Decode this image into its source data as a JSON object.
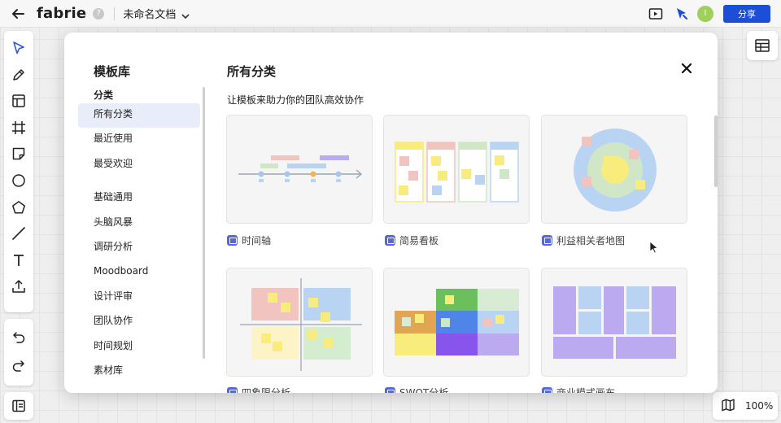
{
  "topbar": {
    "brand": "fabrie",
    "help": "?",
    "doc_title": "未命名文档",
    "avatar_initial": "I",
    "share_label": "分享"
  },
  "left_tools": [
    "select-icon",
    "pen-icon",
    "template-icon",
    "frame-icon",
    "sticky-note-icon",
    "circle-icon",
    "polygon-icon",
    "line-icon",
    "text-icon",
    "upload-icon"
  ],
  "history_tools": [
    "undo-icon",
    "redo-icon"
  ],
  "zoom": {
    "value": "100%"
  },
  "modal": {
    "library_title": "模板库",
    "category_heading": "分类",
    "categories_top": [
      "所有分类",
      "最近使用",
      "最受欢迎"
    ],
    "categories_bottom": [
      "基础通用",
      "头脑风暴",
      "调研分析",
      "Moodboard",
      "设计评审",
      "团队协作",
      "时间规划",
      "素材库"
    ],
    "active_category": "所有分类",
    "main_title": "所有分类",
    "subtitle": "让模板来助力你的团队高效协作",
    "templates": [
      {
        "name": "时间轴"
      },
      {
        "name": "简易看板"
      },
      {
        "name": "利益相关者地图"
      },
      {
        "name": "四象限分析"
      },
      {
        "name": "SWOT分析"
      },
      {
        "name": "商业模式画布"
      }
    ]
  },
  "colors": {
    "accent": "#1d4ed8",
    "active_bg": "#e9edf9",
    "template_icon": "#5568d6"
  }
}
